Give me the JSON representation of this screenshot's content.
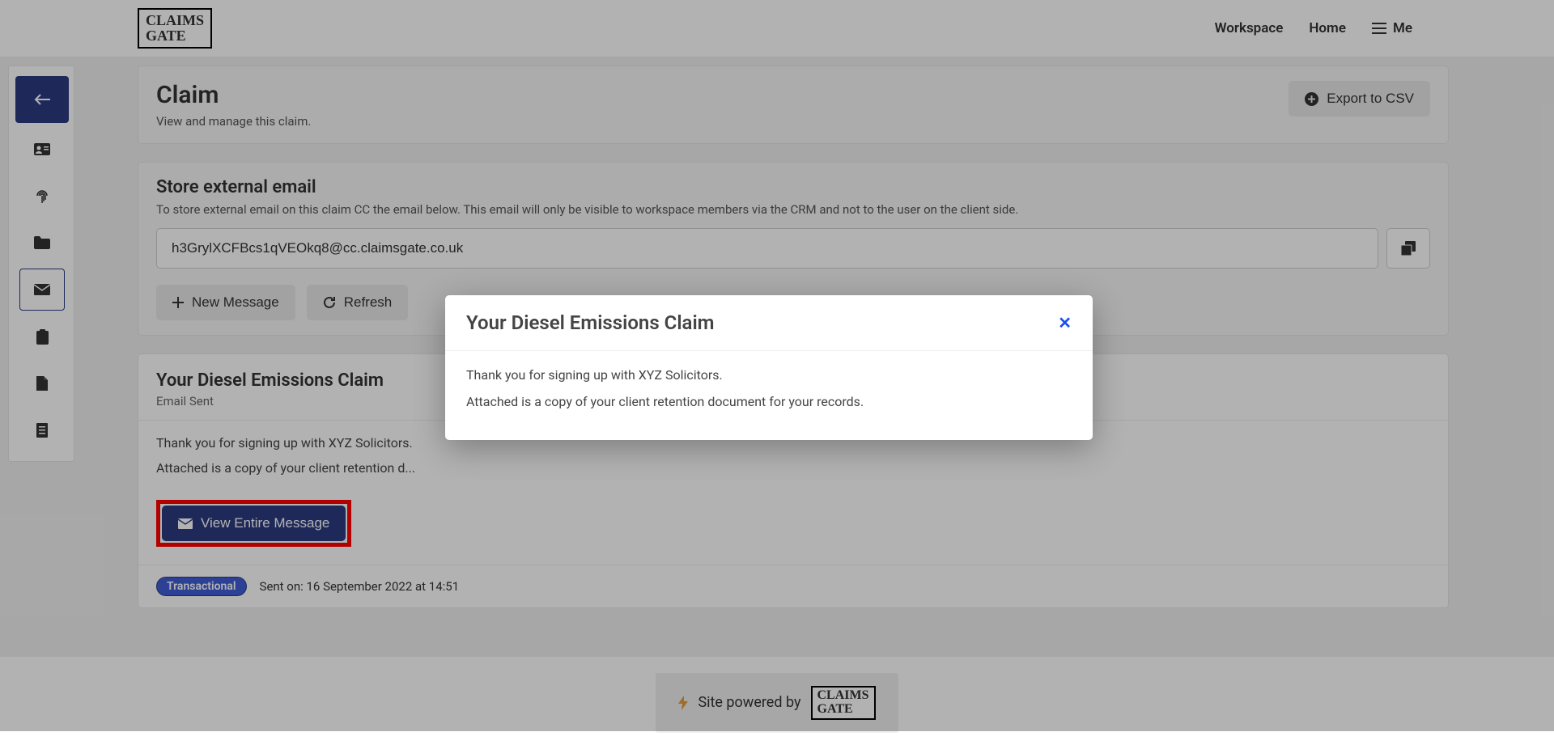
{
  "logo": {
    "line1": "CLAIMS",
    "line2": "GATE"
  },
  "nav": {
    "workspace": "Workspace",
    "home": "Home",
    "me": "Me"
  },
  "claim_panel": {
    "title": "Claim",
    "subtitle": "View and manage this claim.",
    "export": "Export to CSV"
  },
  "email_panel": {
    "title": "Store external email",
    "desc": "To store external email on this claim CC the email below. This email will only be visible to workspace members via the CRM and not to the user on the client side.",
    "address": "h3GrylXCFBcs1qVEOkq8@cc.claimsgate.co.uk",
    "new_message": "New Message",
    "refresh": "Refresh"
  },
  "message": {
    "title": "Your Diesel Emissions Claim",
    "status": "Email Sent",
    "line1": "Thank you for signing up with XYZ Solicitors.",
    "line2_truncated": "Attached is a copy of your client retention d...",
    "view_button": "View Entire Message",
    "badge": "Transactional",
    "sent_on": "Sent on: 16 September 2022 at 14:51"
  },
  "modal": {
    "title": "Your Diesel Emissions Claim",
    "line1": "Thank you for signing up with XYZ Solicitors.",
    "line2": "Attached is a copy of your client retention document for your records."
  },
  "footer": {
    "powered": "Site powered by"
  }
}
